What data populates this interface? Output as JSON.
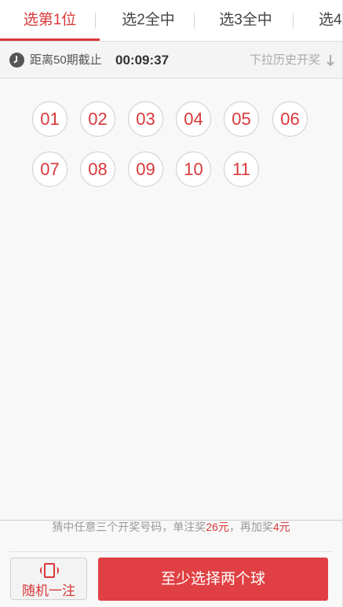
{
  "tabs": [
    {
      "label": "选第1位",
      "active": true
    },
    {
      "label": "选2全中",
      "active": false
    },
    {
      "label": "选3全中",
      "active": false
    },
    {
      "label": "选4",
      "active": false
    }
  ],
  "countdown": {
    "label": "距离50期截止",
    "time": "00:09:37",
    "history_label": "下拉历史开奖"
  },
  "balls": [
    "01",
    "02",
    "03",
    "04",
    "05",
    "06",
    "07",
    "08",
    "09",
    "10",
    "11"
  ],
  "footer": {
    "hint_prefix": "猜中任意三个开奖号码，单注奖",
    "prize": "26元",
    "hint_middle": "，再加奖",
    "bonus": "4元",
    "random_label": "随机一注",
    "confirm_label": "至少选择两个球"
  },
  "colors": {
    "accent": "#d9383a",
    "button": "#e04043"
  }
}
